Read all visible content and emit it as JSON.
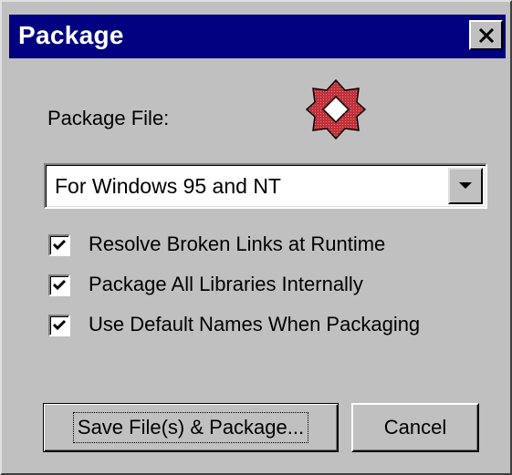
{
  "window": {
    "title": "Package",
    "close_icon": "close-icon"
  },
  "package_file": {
    "label": "Package File:",
    "icon": "package-icon",
    "selected": "For Windows 95 and NT"
  },
  "options": [
    {
      "label": "Resolve Broken Links at Runtime",
      "checked": true
    },
    {
      "label": "Package All Libraries Internally",
      "checked": true
    },
    {
      "label": "Use Default Names When Packaging",
      "checked": true
    }
  ],
  "buttons": {
    "save_label": "Save File(s) & Package...",
    "cancel_label": "Cancel"
  },
  "colors": {
    "titlebar": "#000080",
    "face": "#c0c0c0",
    "icon_red": "#c0303a"
  }
}
